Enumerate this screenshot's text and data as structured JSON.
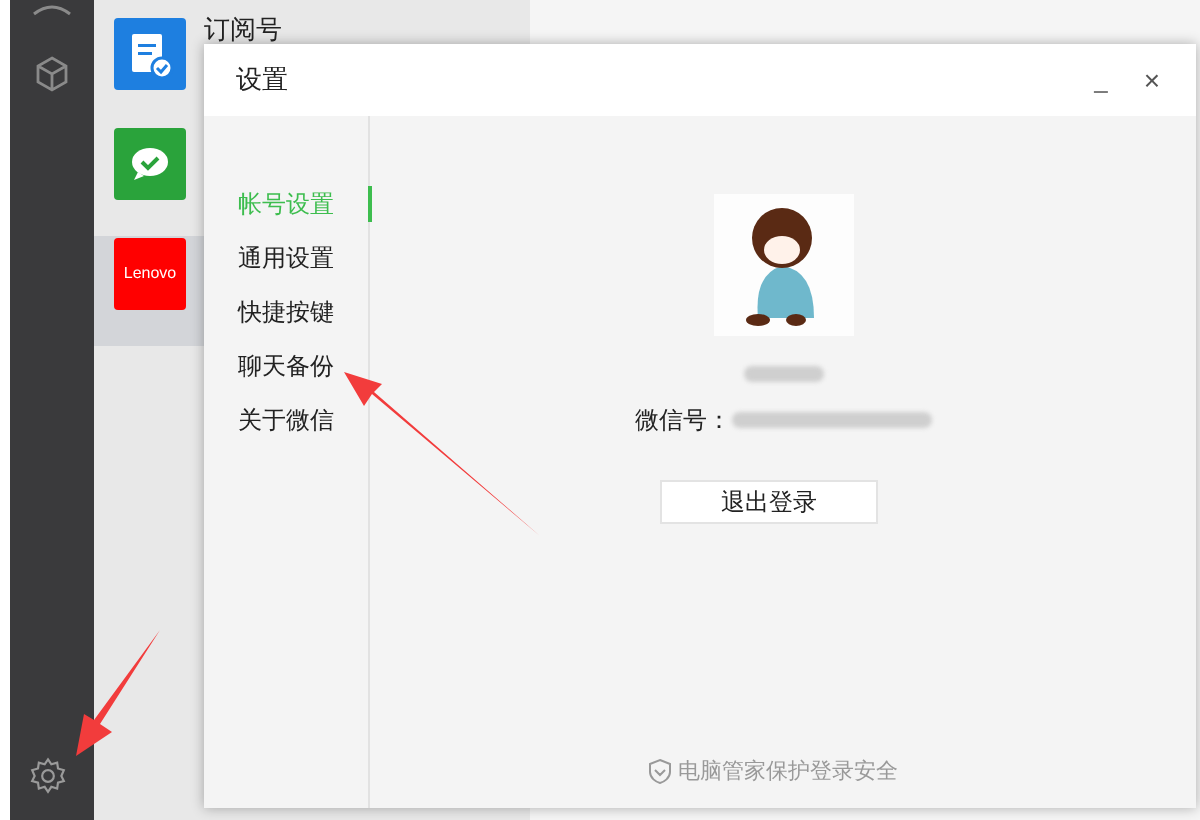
{
  "chat_list": [
    {
      "kind": "subscription",
      "title": "订阅号",
      "selected": false
    },
    {
      "kind": "wechat",
      "selected": false
    },
    {
      "kind": "logo",
      "logo_text": "Lenovo",
      "selected": true
    }
  ],
  "dialog": {
    "title": "设置",
    "minimize": "_",
    "close": "×",
    "nav": [
      {
        "label": "帐号设置",
        "selected": true
      },
      {
        "label": "通用设置",
        "selected": false
      },
      {
        "label": "快捷按键",
        "selected": false
      },
      {
        "label": "聊天备份",
        "selected": false
      },
      {
        "label": "关于微信",
        "selected": false
      }
    ],
    "account": {
      "id_label": "微信号：",
      "logout_button": "退出登录"
    },
    "footer": "电脑管家保护登录安全"
  }
}
